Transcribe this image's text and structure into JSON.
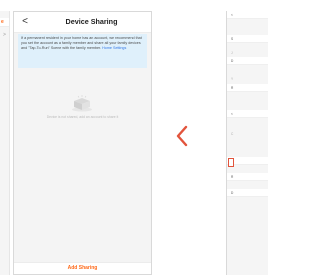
{
  "left_panel": {
    "accent_letter": "e",
    "chevron": ">"
  },
  "device_sharing": {
    "back_glyph": "<",
    "title": "Device Sharing",
    "notice_text": "If a permanent resident in your home has an account, we recommend that you set the account as a family member and share all your family devices and \"Tap-To-Run\" Scene with the family member.",
    "notice_link": "Home Settings",
    "empty_message": "Device is not shared, add an account to share it",
    "add_button": "Add Sharing"
  },
  "right_panel": {
    "rows": [
      "<",
      "S",
      "",
      "D",
      "",
      "R",
      "",
      "<",
      "",
      "S",
      "R",
      "D"
    ],
    "captions": [
      "J",
      "Y",
      "C"
    ]
  },
  "colors": {
    "accent": "#ff6a1a",
    "link": "#3578e5",
    "notice_bg": "#dff0fb",
    "chevron": "#e2543c"
  }
}
